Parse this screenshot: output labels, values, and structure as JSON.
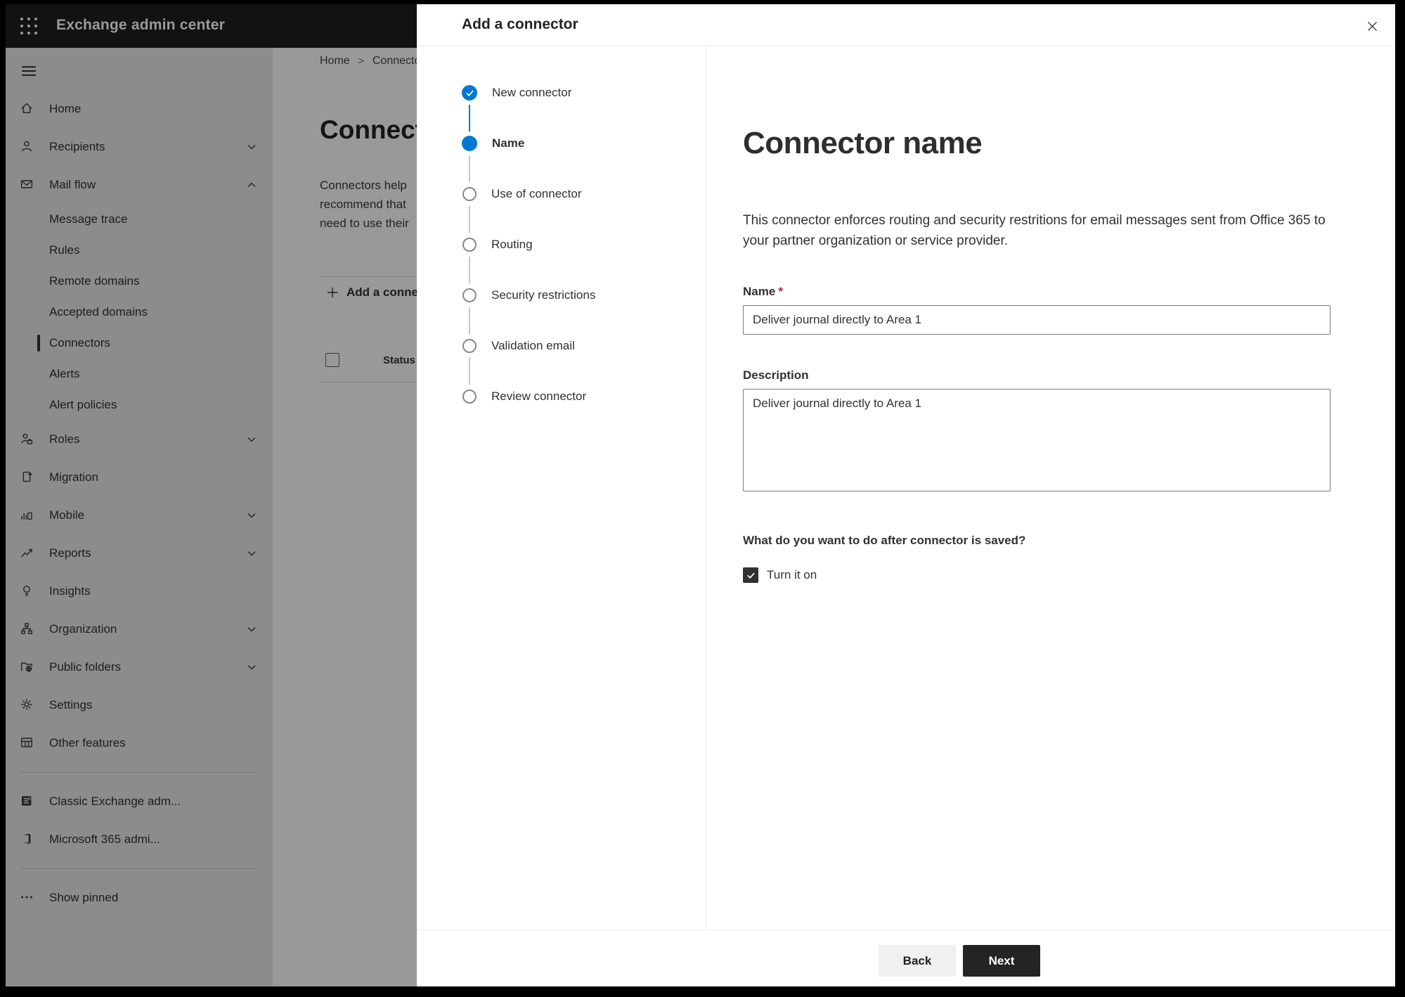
{
  "topbar": {
    "title": "Exchange admin center",
    "app_launcher_icon": "waffle-icon"
  },
  "sidebar": {
    "items": [
      {
        "label": "Home",
        "icon": "home",
        "level": 1
      },
      {
        "label": "Recipients",
        "icon": "person",
        "level": 1,
        "chevron": "down"
      },
      {
        "label": "Mail flow",
        "icon": "mail",
        "level": 1,
        "chevron": "up"
      },
      {
        "label": "Message trace",
        "level": 2
      },
      {
        "label": "Rules",
        "level": 2
      },
      {
        "label": "Remote domains",
        "level": 2
      },
      {
        "label": "Accepted domains",
        "level": 2
      },
      {
        "label": "Connectors",
        "level": 2,
        "selected": true
      },
      {
        "label": "Alerts",
        "level": 2
      },
      {
        "label": "Alert policies",
        "level": 2
      },
      {
        "label": "Roles",
        "icon": "roles",
        "level": 1,
        "chevron": "down"
      },
      {
        "label": "Migration",
        "icon": "migration",
        "level": 1
      },
      {
        "label": "Mobile",
        "icon": "mobile",
        "level": 1,
        "chevron": "down"
      },
      {
        "label": "Reports",
        "icon": "reports",
        "level": 1,
        "chevron": "down"
      },
      {
        "label": "Insights",
        "icon": "insights",
        "level": 1
      },
      {
        "label": "Organization",
        "icon": "organization",
        "level": 1,
        "chevron": "down"
      },
      {
        "label": "Public folders",
        "icon": "public-folders",
        "level": 1,
        "chevron": "down"
      },
      {
        "label": "Settings",
        "icon": "settings",
        "level": 1
      },
      {
        "label": "Other features",
        "icon": "other-features",
        "level": 1
      },
      {
        "divider": true
      },
      {
        "label": "Classic Exchange adm...",
        "icon": "classic-exchange",
        "level": 1
      },
      {
        "label": "Microsoft 365 admi...",
        "icon": "m365",
        "level": 1
      },
      {
        "divider": true
      },
      {
        "label": "Show pinned",
        "icon": "dots",
        "level": 1
      }
    ]
  },
  "main": {
    "breadcrumb": {
      "home": "Home",
      "separator": ">",
      "current": "Connectors"
    },
    "title": "Connectors",
    "intro_lines": [
      "Connectors help",
      "recommend that",
      "need to use their"
    ],
    "add_button_label": "Add a connector",
    "status_column": "Status"
  },
  "modal": {
    "title": "Add a connector",
    "steps": [
      {
        "label": "New connector",
        "state": "completed"
      },
      {
        "label": "Name",
        "state": "active"
      },
      {
        "label": "Use of connector",
        "state": "upcoming"
      },
      {
        "label": "Routing",
        "state": "upcoming"
      },
      {
        "label": "Security restrictions",
        "state": "upcoming"
      },
      {
        "label": "Validation email",
        "state": "upcoming"
      },
      {
        "label": "Review connector",
        "state": "upcoming"
      }
    ],
    "content": {
      "heading": "Connector name",
      "description": "This connector enforces routing and security restritions for email messages sent from Office 365 to your partner organization or service provider.",
      "name_label": "Name",
      "required_mark": "*",
      "name_value": "Deliver journal directly to Area 1",
      "description_label": "Description",
      "description_value": "Deliver journal directly to Area 1",
      "after_save_question": "What do you want to do after connector is saved?",
      "turn_on_label": "Turn it on",
      "turn_on_checked": true
    },
    "footer": {
      "back_label": "Back",
      "next_label": "Next"
    }
  },
  "colors": {
    "accent": "#0078d4",
    "topbar_bg": "#1f1e1d",
    "dark_button": "#252423",
    "required_red": "#a4262c",
    "step_inactive_line": "#c8c6c4"
  }
}
